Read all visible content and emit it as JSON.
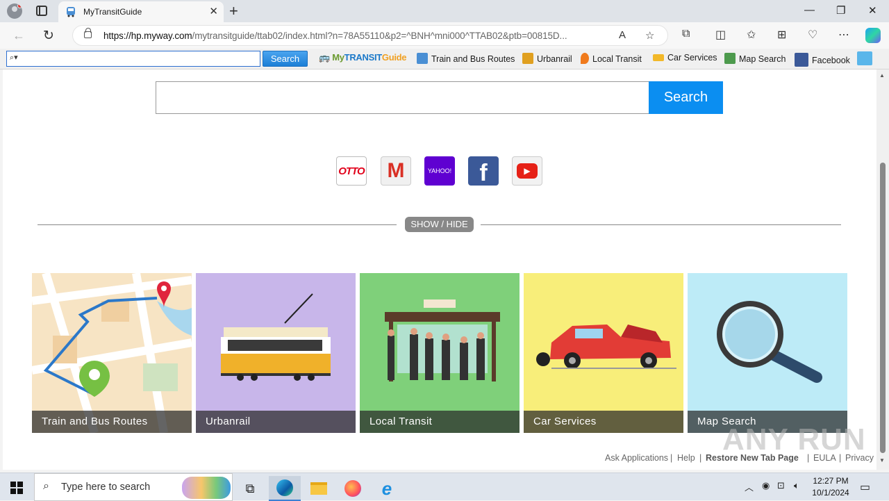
{
  "browser": {
    "tab_title": "MyTransitGuide",
    "url_host": "https://hp.myway.com",
    "url_path": "/mytransitguide/ttab02/index.html?n=78A55110&p2=^BNH^mni000^TTAB02&ptb=00815D...",
    "new_tab": "+",
    "minimize": "—",
    "maximize": "❐",
    "close": "✕"
  },
  "toolbar": {
    "search_placeholder": "",
    "search_button": "Search",
    "logo_my": "My",
    "logo_transit": "TRANSIT",
    "logo_guide": "Guide",
    "items": [
      {
        "label": "Train and Bus Routes",
        "color": "#4a8fd4"
      },
      {
        "label": "Urbanrail",
        "color": "#e0a020"
      },
      {
        "label": "Local Transit",
        "color": "#f07a1c"
      },
      {
        "label": "Car Services",
        "color": "#f2b829"
      },
      {
        "label": "Map Search",
        "color": "#4d9a4d"
      },
      {
        "label": "Facebook",
        "color": "#3b5998"
      }
    ]
  },
  "main": {
    "search_value": "",
    "search_button": "Search",
    "shortcuts": [
      {
        "name": "otto",
        "label": "OTTO",
        "bg": "#ffffff",
        "fg": "#e1001a"
      },
      {
        "name": "gmail",
        "label": "M",
        "bg": "#f2f2f2",
        "fg": "#d93025"
      },
      {
        "name": "yahoo",
        "label": "YAHOO!",
        "bg": "#5f01d1",
        "fg": "#ffffff"
      },
      {
        "name": "facebook",
        "label": "f",
        "bg": "#3b5998",
        "fg": "#ffffff"
      },
      {
        "name": "youtube",
        "label": "▶",
        "bg": "#f2f2f2",
        "fg": "#ffffff"
      }
    ],
    "show_hide": "SHOW / HIDE",
    "tiles": [
      {
        "label": "Train and Bus Routes",
        "bg": "#f7e4c4"
      },
      {
        "label": "Urbanrail",
        "bg": "#c8b6ea"
      },
      {
        "label": "Local Transit",
        "bg": "#7fd07a"
      },
      {
        "label": "Car Services",
        "bg": "#f8ee7a"
      },
      {
        "label": "Map Search",
        "bg": "#bdebf7"
      }
    ],
    "footer_links": [
      "Ask Applications",
      "Help",
      "Restore New Tab Page",
      "EULA",
      "Privacy"
    ],
    "watermark": "ANY RUN"
  },
  "taskbar": {
    "search_placeholder": "Type here to search",
    "time": "12:27 PM",
    "date": "10/1/2024"
  }
}
